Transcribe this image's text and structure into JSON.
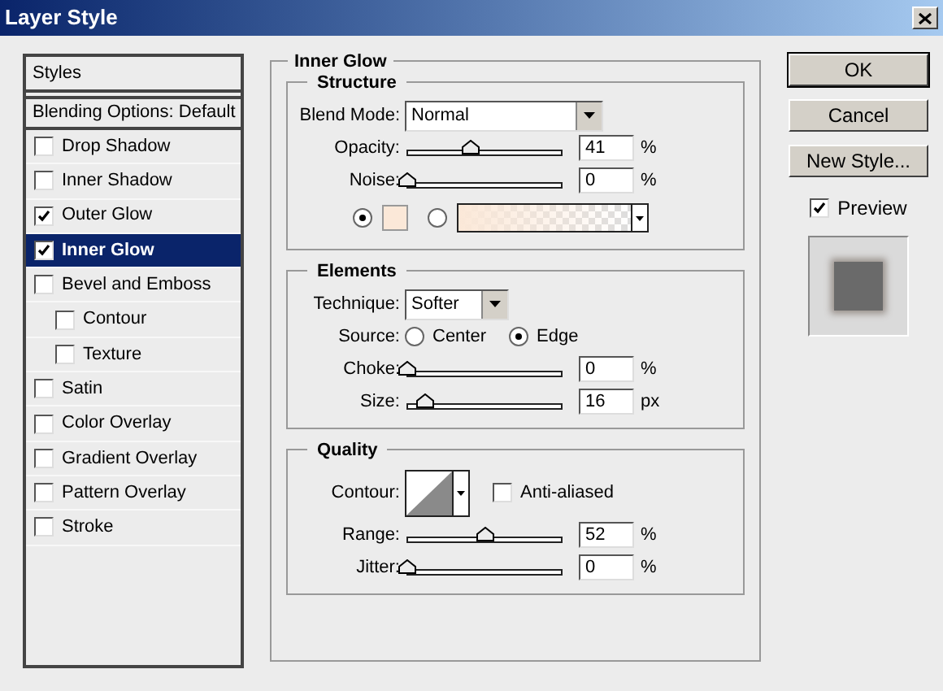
{
  "window": {
    "title": "Layer Style"
  },
  "sidebar": {
    "header": "Styles",
    "blending": "Blending Options: Default",
    "items": [
      {
        "label": "Drop Shadow",
        "checked": false,
        "selected": false
      },
      {
        "label": "Inner Shadow",
        "checked": false,
        "selected": false
      },
      {
        "label": "Outer Glow",
        "checked": true,
        "selected": false
      },
      {
        "label": "Inner Glow",
        "checked": true,
        "selected": true
      },
      {
        "label": "Bevel and Emboss",
        "checked": false,
        "selected": false,
        "children": [
          {
            "label": "Contour",
            "checked": false,
            "selected": false
          },
          {
            "label": "Texture",
            "checked": false,
            "selected": false
          }
        ]
      },
      {
        "label": "Satin",
        "checked": false,
        "selected": false
      },
      {
        "label": "Color Overlay",
        "checked": false,
        "selected": false
      },
      {
        "label": "Gradient Overlay",
        "checked": false,
        "selected": false
      },
      {
        "label": "Pattern Overlay",
        "checked": false,
        "selected": false
      },
      {
        "label": "Stroke",
        "checked": false,
        "selected": false
      }
    ]
  },
  "panel": {
    "title": "Inner Glow",
    "sections": [
      {
        "title": "Structure",
        "rows": [
          {
            "kind": "select",
            "label": "Blend Mode:",
            "value": "Normal"
          },
          {
            "kind": "slider",
            "label": "Opacity:",
            "value": "41",
            "unit": "%",
            "level": 0.41
          },
          {
            "kind": "slider",
            "label": "Noise:",
            "value": "0",
            "unit": "%",
            "level": 0
          },
          {
            "kind": "fill",
            "options": [
              {
                "kind": "swatch",
                "selected": true,
                "color": "#fbe8d8"
              },
              {
                "kind": "gradient",
                "selected": false,
                "color": "#fbe8d8"
              }
            ]
          }
        ]
      },
      {
        "title": "Elements",
        "rows": [
          {
            "kind": "select",
            "label": "Technique:",
            "value": "Softer"
          },
          {
            "kind": "radio",
            "label": "Source:",
            "options": [
              {
                "label": "Center",
                "selected": false
              },
              {
                "label": "Edge",
                "selected": true
              }
            ]
          },
          {
            "kind": "slider",
            "label": "Choke:",
            "value": "0",
            "unit": "%",
            "level": 0
          },
          {
            "kind": "slider",
            "label": "Size:",
            "value": "16",
            "unit": "px",
            "level": 0.12
          }
        ]
      },
      {
        "title": "Quality",
        "rows": [
          {
            "kind": "contour",
            "label": "Contour:",
            "checkbox": {
              "label": "Anti-aliased",
              "checked": false
            }
          },
          {
            "kind": "slider",
            "label": "Range:",
            "value": "52",
            "unit": "%",
            "level": 0.51
          },
          {
            "kind": "slider",
            "label": "Jitter:",
            "value": "0",
            "unit": "%",
            "level": 0
          }
        ]
      }
    ]
  },
  "buttons": [
    "OK",
    "Cancel",
    "New Style..."
  ],
  "preview": {
    "label": "Preview",
    "checked": true
  }
}
